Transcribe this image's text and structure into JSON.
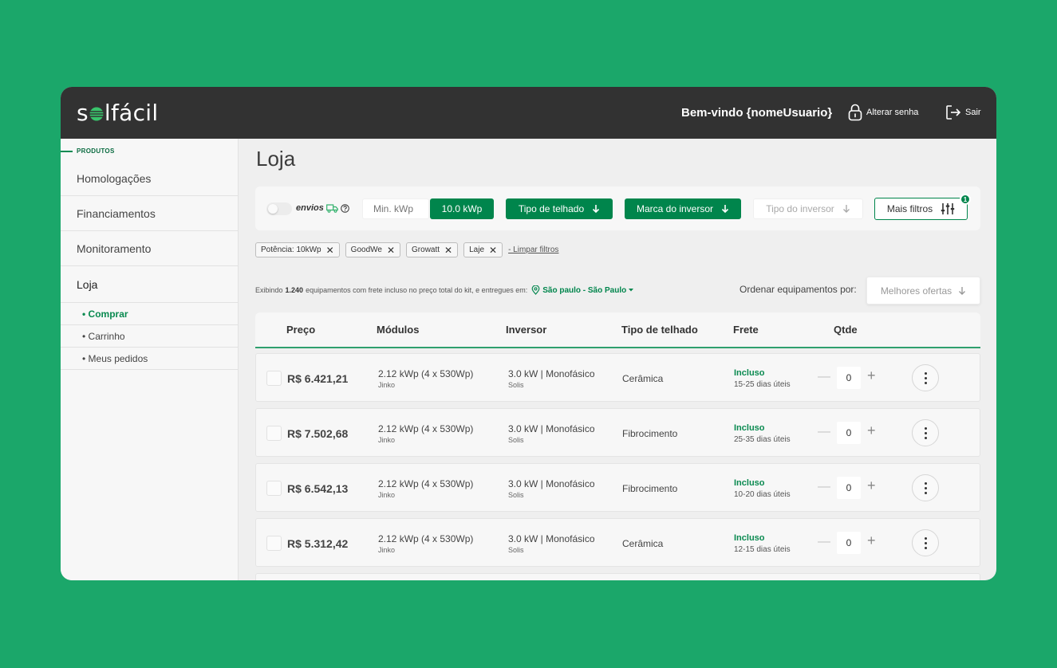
{
  "header": {
    "logo": {
      "prefix": "s",
      "suffix": "lfácil"
    },
    "welcome": "Bem-vindo {nomeUsuario}",
    "change_password": "Alterar senha",
    "logout": "Sair"
  },
  "sidebar": {
    "section": "PRODUTOS",
    "items": [
      {
        "label": "Homologações"
      },
      {
        "label": "Financiamentos"
      },
      {
        "label": "Monitoramento"
      },
      {
        "label": "Loja"
      }
    ],
    "subitems": [
      {
        "label": "• Comprar"
      },
      {
        "label": "• Carrinho"
      },
      {
        "label": "• Meus pedidos"
      }
    ]
  },
  "main": {
    "title": "Loja",
    "filters": {
      "envios_label": "envios",
      "min_kwp_placeholder": "Min. kWp",
      "kwp_value": "10.0 kWp",
      "tipo_telhado": "Tipo de telhado",
      "marca_inversor": "Marca do inversor",
      "tipo_inversor": "Tipo do inversor",
      "mais_filtros": "Mais filtros",
      "badge_count": "1"
    },
    "chips": [
      {
        "label": "Potência: 10kWp"
      },
      {
        "label": "GoodWe"
      },
      {
        "label": "Growatt"
      },
      {
        "label": "Laje"
      }
    ],
    "clear_filters": "- Limpar filtros",
    "showing": {
      "prefix": "Exibindo",
      "count": "1.240",
      "suffix": "equipamentos com frete incluso no preço total do kit, e entregues em:",
      "location": "São paulo - São Paulo"
    },
    "sort": {
      "label": "Ordenar equipamentos por:",
      "value": "Melhores ofertas"
    },
    "table": {
      "columns": [
        "Preço",
        "Módulos",
        "Inversor",
        "Tipo de telhado",
        "Frete",
        "Qtde"
      ],
      "rows": [
        {
          "price": "R$ 6.421,21",
          "modulos": "2.12 kWp (4 x 530Wp)",
          "modulos_brand": "Jinko",
          "inversor": "3.0 kW | Monofásico",
          "inversor_brand": "Solis",
          "telhado": "Cerâmica",
          "frete": "Incluso",
          "prazo": "15-25 dias úteis",
          "qtde": "0"
        },
        {
          "price": "R$ 7.502,68",
          "modulos": "2.12 kWp (4 x 530Wp)",
          "modulos_brand": "Jinko",
          "inversor": "3.0 kW | Monofásico",
          "inversor_brand": "Solis",
          "telhado": "Fibrocimento",
          "frete": "Incluso",
          "prazo": "25-35 dias úteis",
          "qtde": "0"
        },
        {
          "price": "R$ 6.542,13",
          "modulos": "2.12 kWp (4 x 530Wp)",
          "modulos_brand": "Jinko",
          "inversor": "3.0 kW | Monofásico",
          "inversor_brand": "Solis",
          "telhado": "Fibrocimento",
          "frete": "Incluso",
          "prazo": "10-20 dias úteis",
          "qtde": "0"
        },
        {
          "price": "R$ 5.312,42",
          "modulos": "2.12 kWp (4 x 530Wp)",
          "modulos_brand": "Jinko",
          "inversor": "3.0 kW | Monofásico",
          "inversor_brand": "Solis",
          "telhado": "Cerâmica",
          "frete": "Incluso",
          "prazo": "12-15 dias úteis",
          "qtde": "0"
        }
      ]
    }
  },
  "colors": {
    "background": "#1ba76a",
    "header": "#323232",
    "brand_green": "#00854c",
    "accent_green": "#0a8a50"
  }
}
